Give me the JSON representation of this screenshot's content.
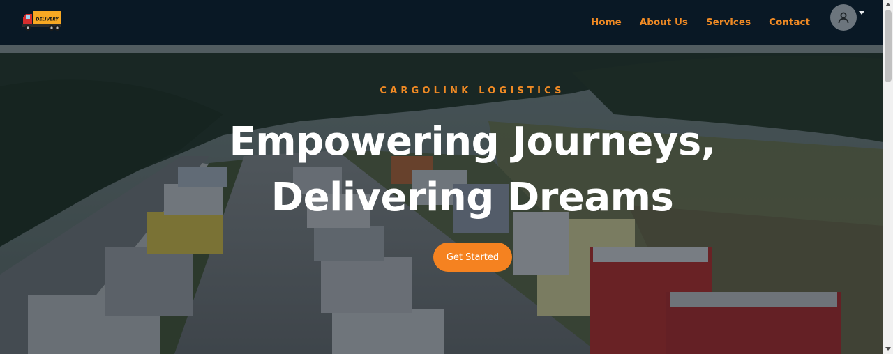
{
  "navbar": {
    "logo": {
      "icon": "delivery-truck-icon",
      "text": "DELIVERY"
    },
    "links": [
      {
        "label": "Home"
      },
      {
        "label": "About Us"
      },
      {
        "label": "Services"
      },
      {
        "label": "Contact"
      }
    ],
    "user_menu": {
      "icon": "user-avatar-icon"
    }
  },
  "hero": {
    "brand": "CARGOLINK LOGISTICS",
    "headline_line1": "Empowering Journeys,",
    "headline_line2": "Delivering Dreams",
    "cta_label": "Get Started",
    "background": "highway-with-trucks-photo"
  },
  "colors": {
    "navbar_bg": "#091825",
    "accent": "#f08a24",
    "cta_bg": "#f58220",
    "headline": "#ffffff"
  }
}
